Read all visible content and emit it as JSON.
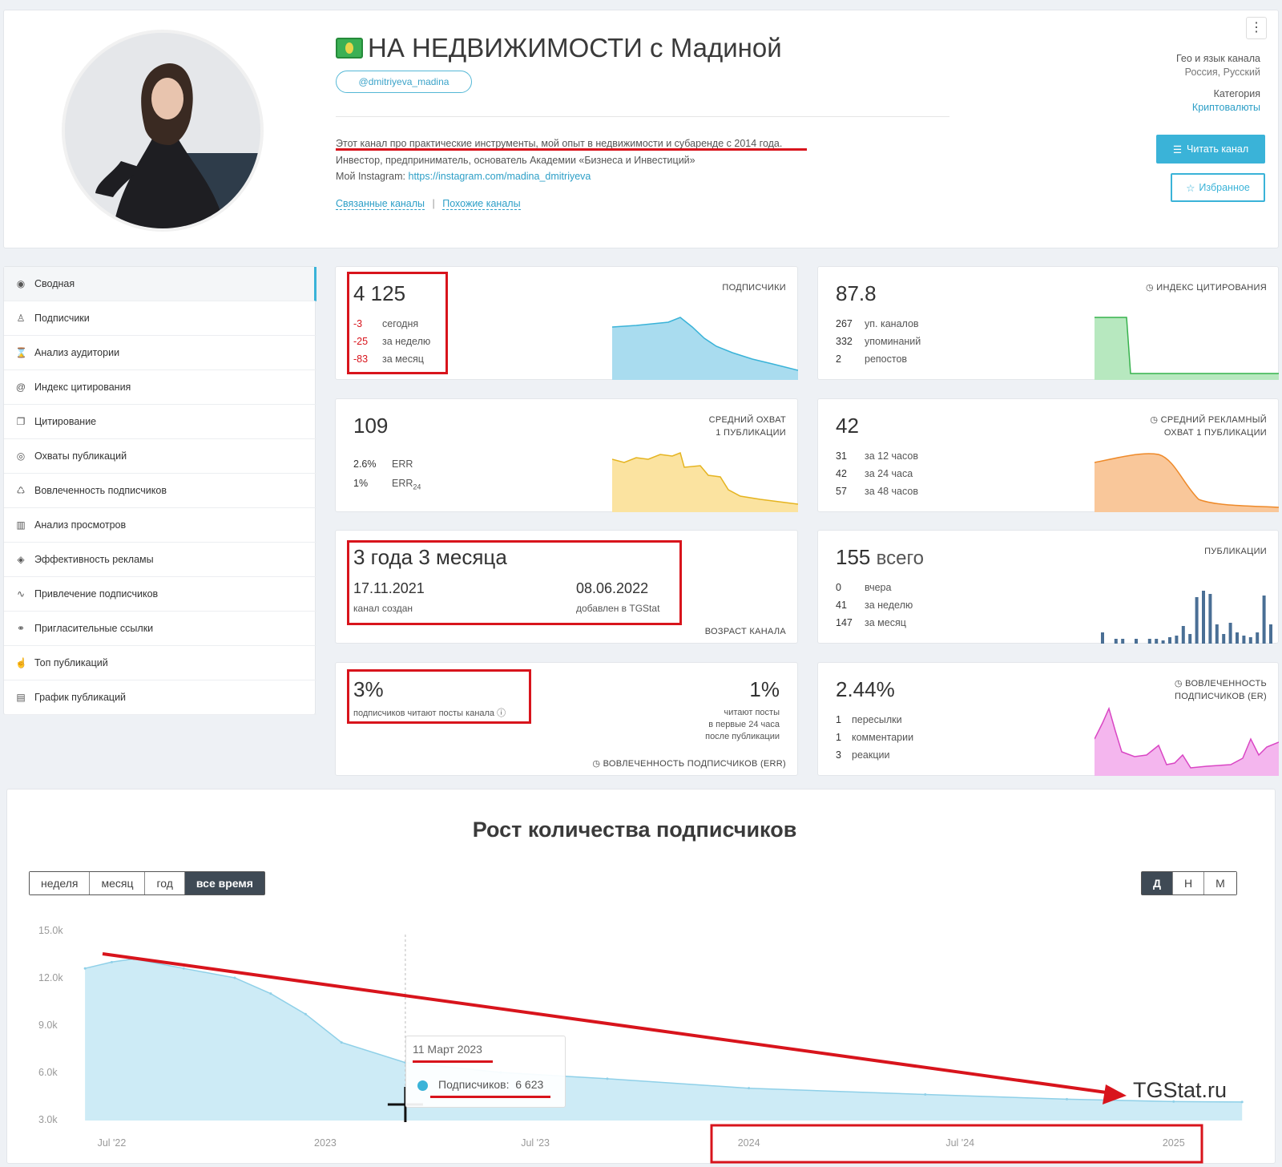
{
  "header": {
    "title": "НА НЕДВИЖИМОСТИ с Мадиной",
    "username": "@dmitriyeva_madina",
    "description_line1": "Этот канал про практические инструменты, мой опыт в недвижимости и субаренде с 2014 года.",
    "description_line2": "Инвестор, предприниматель, основатель Академии «Бизнеса и Инвестиций»",
    "instagram_label": "Мой Instagram: ",
    "instagram_link": "https://instagram.com/madina_dmitriyeva",
    "related_channels": "Связанные каналы",
    "separator": "|",
    "similar_channels": "Похожие каналы",
    "geo_label": "Гео и язык канала",
    "geo_value": "Россия, Русский",
    "category_label": "Категория",
    "category_value": "Криптовалюты",
    "read_button": "Читать канал",
    "fav_button": "Избранное",
    "kebab": "⋮"
  },
  "sidebar": {
    "items": [
      {
        "label": "Сводная",
        "icon": "dashboard-icon",
        "glyph": "◉"
      },
      {
        "label": "Подписчики",
        "icon": "users-icon",
        "glyph": "♙"
      },
      {
        "label": "Анализ аудитории",
        "icon": "hourglass-icon",
        "glyph": "⌛"
      },
      {
        "label": "Индекс цитирования",
        "icon": "at-icon",
        "glyph": "@"
      },
      {
        "label": "Цитирование",
        "icon": "copy-icon",
        "glyph": "❐"
      },
      {
        "label": "Охваты публикаций",
        "icon": "eye-icon",
        "glyph": "◎"
      },
      {
        "label": "Вовлеченность подписчиков",
        "icon": "engagement-icon",
        "glyph": "♺"
      },
      {
        "label": "Анализ просмотров",
        "icon": "bar-chart-icon",
        "glyph": "▥"
      },
      {
        "label": "Эффективность рекламы",
        "icon": "tag-icon",
        "glyph": "◈"
      },
      {
        "label": "Привлечение подписчиков",
        "icon": "trend-icon",
        "glyph": "∿"
      },
      {
        "label": "Пригласительные ссылки",
        "icon": "link-icon",
        "glyph": "⚭"
      },
      {
        "label": "Топ публикаций",
        "icon": "thumbs-up-icon",
        "glyph": "☝"
      },
      {
        "label": "График публикаций",
        "icon": "calendar-icon",
        "glyph": "▤"
      }
    ]
  },
  "subscribers": {
    "value": "4 125",
    "caption": "ПОДПИСЧИКИ",
    "rows": [
      {
        "n": "-3",
        "t": "сегодня"
      },
      {
        "n": "-25",
        "t": "за неделю"
      },
      {
        "n": "-83",
        "t": "за месяц"
      }
    ]
  },
  "citation": {
    "value": "87.8",
    "caption": "ИНДЕКС ЦИТИРОВАНИЯ",
    "rows": [
      {
        "n": "267",
        "t": "уп. каналов"
      },
      {
        "n": "332",
        "t": "упоминаний"
      },
      {
        "n": "2",
        "t": "репостов"
      }
    ]
  },
  "reach": {
    "value": "109",
    "caption1": "СРЕДНИЙ ОХВАТ",
    "caption2": "1 ПУБЛИКАЦИИ",
    "rows": [
      {
        "n": "2.6%",
        "t": "ERR"
      },
      {
        "n": "1%",
        "t": "ERR",
        "sub": "24"
      }
    ]
  },
  "ad_reach": {
    "value": "42",
    "caption1": "СРЕДНИЙ РЕКЛАМНЫЙ",
    "caption2": "ОХВАТ 1 ПУБЛИКАЦИИ",
    "rows": [
      {
        "n": "31",
        "t": "за 12 часов"
      },
      {
        "n": "42",
        "t": "за 24 часа"
      },
      {
        "n": "57",
        "t": "за 48 часов"
      }
    ]
  },
  "age": {
    "value": "3 года 3 месяца",
    "created_date": "17.11.2021",
    "created_label": "канал создан",
    "added_date": "08.06.2022",
    "added_label": "добавлен в TGStat",
    "caption": "ВОЗРАСТ КАНАЛА"
  },
  "posts": {
    "value": "155",
    "value_suffix": "всего",
    "caption": "ПУБЛИКАЦИИ",
    "rows": [
      {
        "n": "0",
        "t": "вчера"
      },
      {
        "n": "41",
        "t": "за неделю"
      },
      {
        "n": "147",
        "t": "за месяц"
      }
    ]
  },
  "err": {
    "value": "3%",
    "label": "подписчиков читают посты канала",
    "right_value": "1%",
    "right_label1": "читают посты",
    "right_label2": "в первые 24 часа",
    "right_label3": "после публикации",
    "caption": "ВОВЛЕЧЕННОСТЬ ПОДПИСЧИКОВ (ERR)"
  },
  "er": {
    "value": "2.44%",
    "caption1": "ВОВЛЕЧЕННОСТЬ",
    "caption2": "ПОДПИСЧИКОВ (ER)",
    "rows": [
      {
        "n": "1",
        "t": "пересылки"
      },
      {
        "n": "1",
        "t": "комментарии"
      },
      {
        "n": "3",
        "t": "реакции"
      }
    ]
  },
  "growth": {
    "title": "Рост количества подписчиков",
    "ranges": [
      "неделя",
      "месяц",
      "год",
      "все время"
    ],
    "active_range": "все время",
    "granularity": [
      "Д",
      "Н",
      "М"
    ],
    "active_granularity": "Д",
    "tooltip_date": "11 Март 2023",
    "tooltip_label": "Подписчиков:",
    "tooltip_value": "6 623",
    "watermark": "TGStat.ru"
  },
  "colors": {
    "accent": "#3ab3d8",
    "red_annotation": "#d8141c",
    "subscribers_fill": "#a9dcef",
    "reach_fill": "#fbe3a0",
    "ad_fill": "#f9c79a",
    "citation_fill": "#b7e8bf",
    "er_fill": "#f4b6ee"
  },
  "chart_data": {
    "type": "area",
    "title": "Рост количества подписчиков",
    "y_ticks": [
      "15.0k",
      "12.0k",
      "9.0k",
      "6.0k",
      "3.0k"
    ],
    "x_ticks": [
      "Jul '22",
      "2023",
      "Jul '23",
      "2024",
      "Jul '24",
      "2025"
    ],
    "ylim": [
      3000,
      15000
    ],
    "x": [
      "2022-06-08",
      "2022-07-01",
      "2022-07-20",
      "2022-09-01",
      "2022-10-15",
      "2022-11-15",
      "2022-12-15",
      "2023-01-15",
      "2023-03-11",
      "2023-06-01",
      "2023-09-01",
      "2024-01-01",
      "2024-06-01",
      "2024-10-01",
      "2025-01-01",
      "2025-03-01"
    ],
    "series": [
      {
        "name": "Подписчиков",
        "values": [
          12600,
          13000,
          13200,
          12600,
          12000,
          11000,
          9700,
          7900,
          6623,
          6000,
          5600,
          5000,
          4600,
          4300,
          4150,
          4125
        ]
      }
    ]
  }
}
